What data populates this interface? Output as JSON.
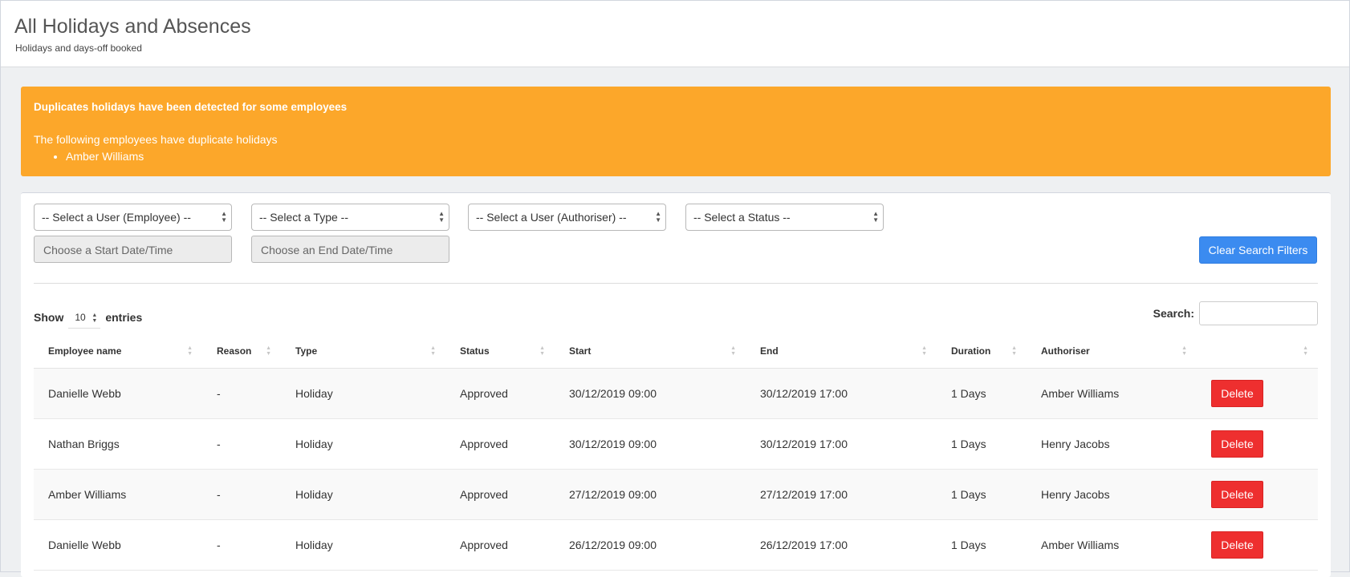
{
  "header": {
    "title": "All Holidays and Absences",
    "subtitle": "Holidays and days-off booked"
  },
  "alert": {
    "color": "#fca72a",
    "title": "Duplicates holidays have been detected for some employees",
    "text": "The following employees have duplicate holidays",
    "employees": [
      "Amber Williams"
    ]
  },
  "filters": {
    "employee_select": "-- Select a User (Employee) --",
    "type_select": "-- Select a Type --",
    "authoriser_select": "-- Select a User (Authoriser) --",
    "status_select": "-- Select a Status --",
    "start_date_placeholder": "Choose a Start Date/Time",
    "end_date_placeholder": "Choose an End Date/Time",
    "clear_button": "Clear Search Filters"
  },
  "table_controls": {
    "show_label": "Show",
    "entries_value": "10",
    "entries_label": "entries",
    "search_label": "Search:"
  },
  "table": {
    "columns": [
      "Employee name",
      "Reason",
      "Type",
      "Status",
      "Start",
      "End",
      "Duration",
      "Authoriser",
      ""
    ],
    "rows": [
      {
        "employee": "Danielle Webb",
        "reason": "-",
        "type": "Holiday",
        "status": "Approved",
        "start": "30/12/2019 09:00",
        "end": "30/12/2019 17:00",
        "duration": "1 Days",
        "authoriser": "Amber Williams",
        "action": "Delete"
      },
      {
        "employee": "Nathan Briggs",
        "reason": "-",
        "type": "Holiday",
        "status": "Approved",
        "start": "30/12/2019 09:00",
        "end": "30/12/2019 17:00",
        "duration": "1 Days",
        "authoriser": "Henry Jacobs",
        "action": "Delete"
      },
      {
        "employee": "Amber Williams",
        "reason": "-",
        "type": "Holiday",
        "status": "Approved",
        "start": "27/12/2019 09:00",
        "end": "27/12/2019 17:00",
        "duration": "1 Days",
        "authoriser": "Henry Jacobs",
        "action": "Delete"
      },
      {
        "employee": "Danielle Webb",
        "reason": "-",
        "type": "Holiday",
        "status": "Approved",
        "start": "26/12/2019 09:00",
        "end": "26/12/2019 17:00",
        "duration": "1 Days",
        "authoriser": "Amber Williams",
        "action": "Delete"
      }
    ]
  },
  "colors": {
    "primary_button": "#3b8bf0",
    "danger_button": "#ee2f2f"
  }
}
